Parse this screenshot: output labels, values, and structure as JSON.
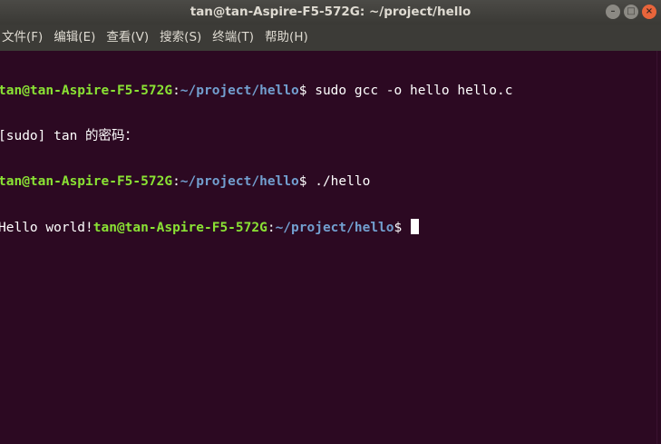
{
  "window": {
    "title": "tan@tan-Aspire-F5-572G: ~/project/hello",
    "controls": {
      "minimize_icon": "minimize-icon",
      "maximize_icon": "maximize-icon",
      "close_icon": "close-icon"
    }
  },
  "menubar": {
    "items": [
      {
        "label": "文件(F)"
      },
      {
        "label": "编辑(E)"
      },
      {
        "label": "查看(V)"
      },
      {
        "label": "搜索(S)"
      },
      {
        "label": "终端(T)"
      },
      {
        "label": "帮助(H)"
      }
    ]
  },
  "terminal": {
    "colors": {
      "background": "#2c0922",
      "prompt_user": "#8ae234",
      "prompt_path": "#729fcf",
      "text": "#ffffff"
    },
    "lines": [
      {
        "user": "tan@tan-Aspire-F5-572G",
        "sep": ":",
        "path": "~/project/hello",
        "suffix": "$ sudo gcc -o hello hello.c"
      },
      {
        "text": "[sudo] tan 的密码："
      },
      {
        "user": "tan@tan-Aspire-F5-572G",
        "sep": ":",
        "path": "~/project/hello",
        "suffix": "$ ./hello"
      },
      {
        "pre": "Hello world!",
        "user": "tan@tan-Aspire-F5-572G",
        "sep": ":",
        "path": "~/project/hello",
        "suffix": "$ "
      }
    ]
  }
}
